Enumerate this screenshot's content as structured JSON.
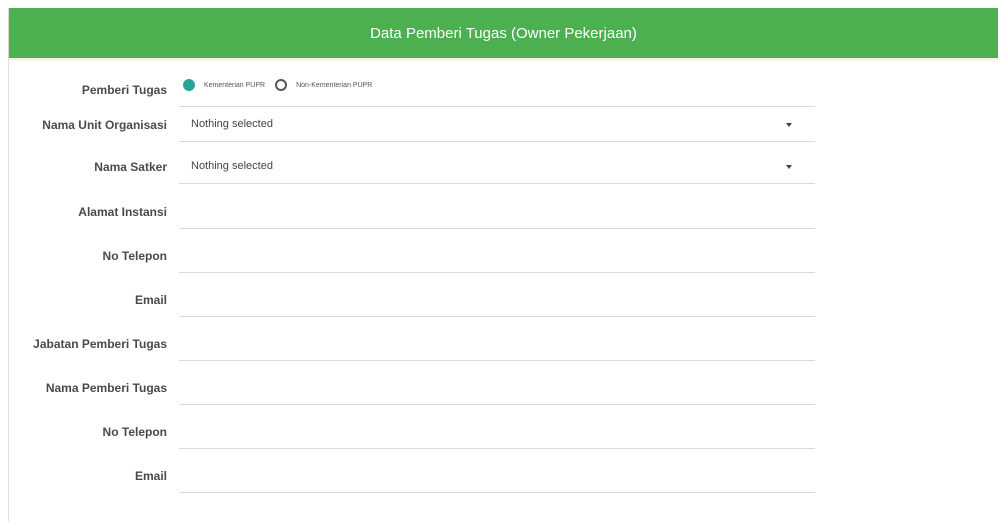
{
  "header": {
    "title": "Data Pemberi Tugas (Owner Pekerjaan)"
  },
  "colors": {
    "header_bg": "#4caf50",
    "radio_checked": "#26a69a"
  },
  "form": {
    "pemberi_tugas": {
      "label": "Pemberi Tugas",
      "options": [
        {
          "label": "Kementerian PUPR",
          "checked": true
        },
        {
          "label": "Non-Kementerian PUPR",
          "checked": false
        }
      ]
    },
    "unit_organisasi": {
      "label": "Nama Unit Organisasi",
      "value": "Nothing selected"
    },
    "satker": {
      "label": "Nama Satker",
      "value": "Nothing selected"
    },
    "alamat_instansi": {
      "label": "Alamat Instansi",
      "value": ""
    },
    "no_telepon_instansi": {
      "label": "No Telepon",
      "value": ""
    },
    "email_instansi": {
      "label": "Email",
      "value": ""
    },
    "jabatan_pemberi_tugas": {
      "label": "Jabatan Pemberi Tugas",
      "value": ""
    },
    "nama_pemberi_tugas": {
      "label": "Nama Pemberi Tugas",
      "value": ""
    },
    "no_telepon_pemberi": {
      "label": "No Telepon",
      "value": ""
    },
    "email_pemberi": {
      "label": "Email",
      "value": ""
    }
  }
}
